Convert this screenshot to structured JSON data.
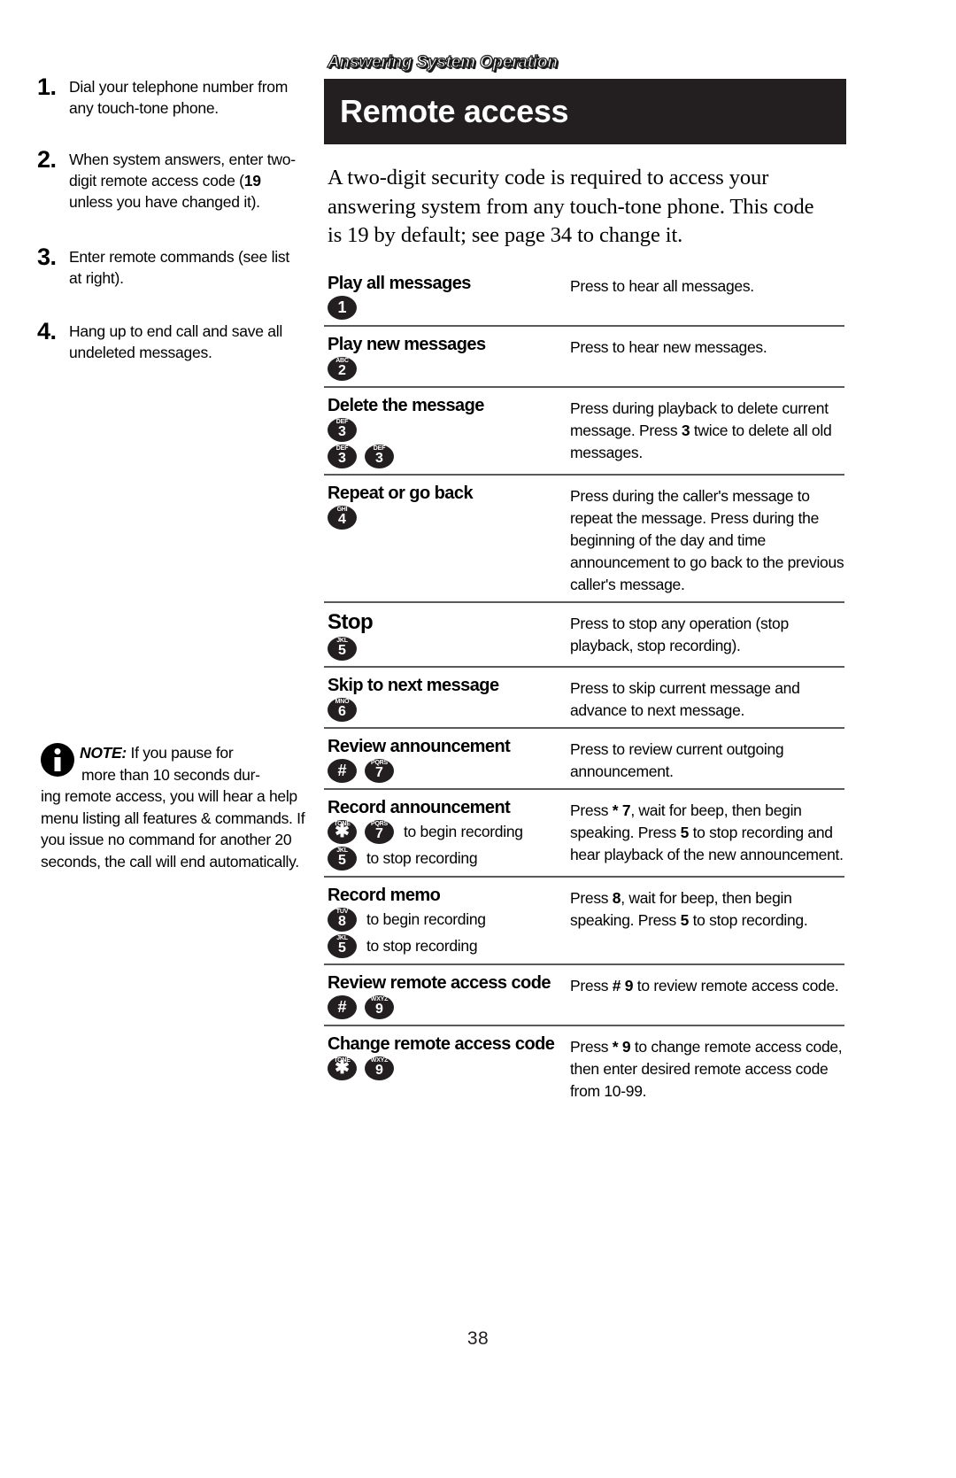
{
  "running_head": "Answering System Operation",
  "page_title": "Remote access",
  "page_number": "38",
  "colors": {
    "title_bar_bg": "#231f20",
    "rule": "#58595b",
    "key_bg": "#231f20",
    "text": "#000000"
  },
  "intro": {
    "line1": "A two-digit security code is required to access your",
    "line2": "answering system from any touch-tone phone. This code",
    "line3": "is 19 by default; see page 34 to change it."
  },
  "steps": [
    {
      "num": "1.",
      "text": "Dial your telephone number from any touch-tone phone."
    },
    {
      "num": "2.",
      "text_before": "When system answers, enter two-digit remote access code (",
      "bold": "19",
      "text_after": " unless you have changed it)."
    },
    {
      "num": "3.",
      "text": "Enter remote commands (see list at right)."
    },
    {
      "num": "4.",
      "text": "Hang up to end call and save all undeleted messages."
    }
  ],
  "note": {
    "label": "NOTE:",
    "line1": "If you pause for",
    "line2": "more than 10 seconds dur-",
    "rest": "ing remote access, you will hear a help menu listing all features & commands. If you issue no command for another 20 seconds, the call will end automatically."
  },
  "commands": [
    {
      "name": "Play all messages",
      "name_size": "normal",
      "keylines": [
        {
          "keys": [
            {
              "letters": "",
              "digit": "1"
            }
          ],
          "suffix": ""
        }
      ],
      "description": "Press to hear all messages."
    },
    {
      "name": "Play new messages",
      "name_size": "normal",
      "keylines": [
        {
          "keys": [
            {
              "letters": "ABC",
              "digit": "2"
            }
          ],
          "suffix": ""
        }
      ],
      "description": "Press to hear new messages."
    },
    {
      "name": "Delete the message",
      "name_size": "normal",
      "keylines": [
        {
          "keys": [
            {
              "letters": "DEF",
              "digit": "3"
            }
          ],
          "suffix": ""
        },
        {
          "keys": [
            {
              "letters": "DEF",
              "digit": "3"
            },
            {
              "letters": "DEF",
              "digit": "3"
            }
          ],
          "suffix": ""
        }
      ],
      "description": "Press during playback to delete current message. Press 3 twice to delete all old messages.",
      "description_parts": [
        {
          "t": "Press during playback to delete current message. Press ",
          "b": false
        },
        {
          "t": "3",
          "b": true
        },
        {
          "t": " twice to delete all old messages.",
          "b": false
        }
      ]
    },
    {
      "name": "Repeat or go back",
      "name_size": "normal",
      "keylines": [
        {
          "keys": [
            {
              "letters": "GHI",
              "digit": "4"
            }
          ],
          "suffix": ""
        }
      ],
      "description": "Press during the caller's message to repeat the message.  Press during the beginning of the day and time announcement to go back to the previous caller's message."
    },
    {
      "name": "Stop",
      "name_size": "big",
      "keylines": [
        {
          "keys": [
            {
              "letters": "JKL",
              "digit": "5"
            }
          ],
          "suffix": ""
        }
      ],
      "description": "Press to stop any operation (stop playback, stop recording)."
    },
    {
      "name": "Skip to next message",
      "name_size": "normal",
      "keylines": [
        {
          "keys": [
            {
              "letters": "MNO",
              "digit": "6"
            }
          ],
          "suffix": ""
        }
      ],
      "description": "Press to skip current message and advance to next message."
    },
    {
      "name": "Review announcement",
      "name_size": "normal",
      "keylines": [
        {
          "keys": [
            {
              "letters": "",
              "digit": "#"
            },
            {
              "letters": "PQRS",
              "digit": "7"
            }
          ],
          "suffix": ""
        }
      ],
      "description": "Press to review current outgoing announcement."
    },
    {
      "name": "Record announcement",
      "name_size": "normal",
      "keylines": [
        {
          "keys": [
            {
              "letters": "TONE",
              "digit": "✱"
            },
            {
              "letters": "PQRS",
              "digit": "7"
            }
          ],
          "suffix": "to begin recording"
        },
        {
          "keys": [
            {
              "letters": "JKL",
              "digit": "5"
            }
          ],
          "suffix": "to stop recording"
        }
      ],
      "description_parts": [
        {
          "t": "Press ",
          "b": false
        },
        {
          "t": "* 7",
          "b": true
        },
        {
          "t": ", wait for beep, then begin speaking. Press ",
          "b": false
        },
        {
          "t": "5",
          "b": true
        },
        {
          "t": " to stop recording and hear playback of the new announcement.",
          "b": false
        }
      ]
    },
    {
      "name": "Record memo",
      "name_size": "normal",
      "keylines": [
        {
          "keys": [
            {
              "letters": "TUV",
              "digit": "8"
            }
          ],
          "suffix": "to begin recording"
        },
        {
          "keys": [
            {
              "letters": "JKL",
              "digit": "5"
            }
          ],
          "suffix": "to stop recording"
        }
      ],
      "description_parts": [
        {
          "t": "Press ",
          "b": false
        },
        {
          "t": "8",
          "b": true
        },
        {
          "t": ", wait for beep, then begin speaking. Press ",
          "b": false
        },
        {
          "t": "5",
          "b": true
        },
        {
          "t": " to stop recording.",
          "b": false
        }
      ]
    },
    {
      "name": "Review remote access code",
      "name_size": "normal",
      "keylines": [
        {
          "keys": [
            {
              "letters": "",
              "digit": "#"
            },
            {
              "letters": "WXYZ",
              "digit": "9"
            }
          ],
          "suffix": ""
        }
      ],
      "description_parts": [
        {
          "t": "Press ",
          "b": false
        },
        {
          "t": "# 9",
          "b": true
        },
        {
          "t": " to review remote access code.",
          "b": false
        }
      ]
    },
    {
      "name": "Change remote access code",
      "name_size": "normal",
      "keylines": [
        {
          "keys": [
            {
              "letters": "TONE",
              "digit": "✱"
            },
            {
              "letters": "WXYZ",
              "digit": "9"
            }
          ],
          "suffix": ""
        }
      ],
      "description_parts": [
        {
          "t": "Press ",
          "b": false
        },
        {
          "t": "* 9",
          "b": true
        },
        {
          "t": " to change remote access code, then enter desired remote access code from 10-99.",
          "b": false
        }
      ]
    }
  ]
}
